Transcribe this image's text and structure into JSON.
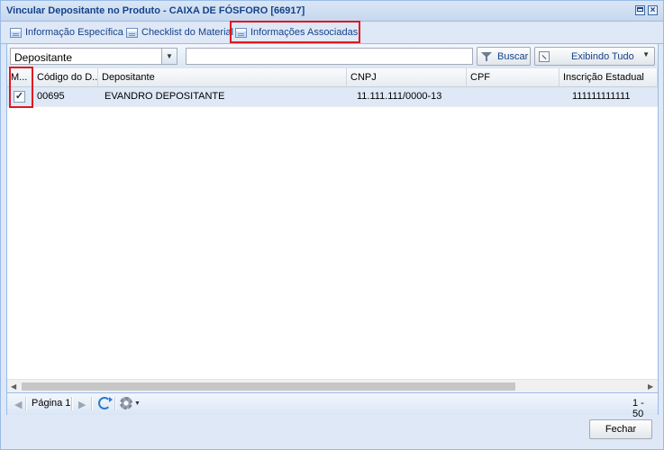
{
  "window": {
    "title": "Vincular Depositante no Produto - CAIXA DE FÓSFORO [66917]",
    "close_glyph": "×"
  },
  "tabs": [
    {
      "label": "Informação Específica",
      "icon": "form-icon"
    },
    {
      "label": "Checklist do Material",
      "icon": "form-icon"
    },
    {
      "label": "Informações Associadas",
      "icon": "form-icon"
    }
  ],
  "toolbar": {
    "filter_field": "Depositante",
    "search_value": "",
    "search_label": "Buscar",
    "view_label": "Exibindo Tudo"
  },
  "grid": {
    "columns": [
      "M...",
      "Código do D...",
      "Depositante",
      "CNPJ",
      "CPF",
      "Inscrição Estadual"
    ],
    "rows": [
      {
        "checked": true,
        "check_glyph": "✓",
        "codigo": "00695",
        "depositante": "EVANDRO DEPOSITANTE",
        "cnpj": "11.111.111/0000-13",
        "cpf": "",
        "inscricao": "111111111111"
      }
    ]
  },
  "pager": {
    "page_label": "Página 1",
    "range": "1 - 50"
  },
  "footer": {
    "close_label": "Fechar"
  },
  "colors": {
    "highlight": "#e0171f",
    "header_text": "#15428b",
    "selected_row": "#dfe8f6"
  }
}
